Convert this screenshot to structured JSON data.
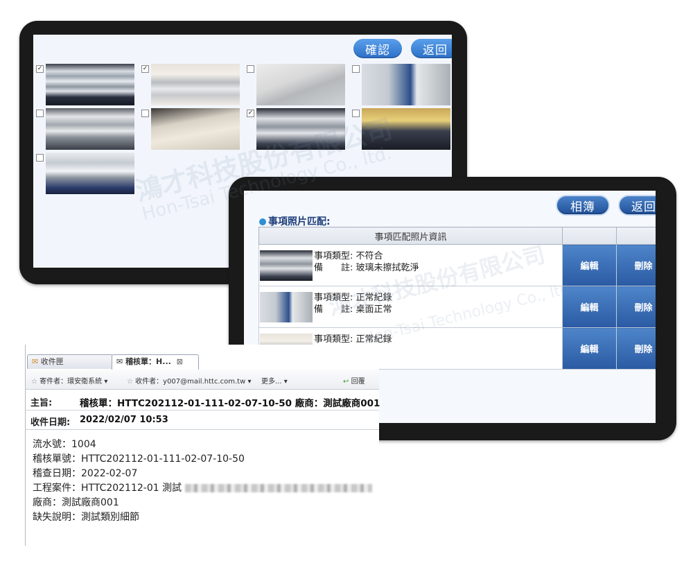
{
  "photo_picker": {
    "confirm_label": "確認",
    "back_label": "返回",
    "photos": [
      {
        "checked": true,
        "thumb": "t1"
      },
      {
        "checked": true,
        "thumb": "t2"
      },
      {
        "checked": false,
        "thumb": "t3"
      },
      {
        "checked": false,
        "thumb": "t4"
      },
      {
        "checked": false,
        "thumb": "t5"
      },
      {
        "checked": false,
        "thumb": "t6"
      },
      {
        "checked": true,
        "thumb": "t7"
      },
      {
        "checked": false,
        "thumb": "t8"
      },
      {
        "checked": false,
        "thumb": "t9"
      }
    ]
  },
  "matching": {
    "album_label": "相簿",
    "back_label": "返回",
    "section_title": "事項照片匹配:",
    "table_header": "事項匹配照片資訊",
    "type_label": "事項類型:",
    "note_label": "備　　註:",
    "edit_label": "編輯",
    "delete_label": "刪除",
    "rows": [
      {
        "type": "不符合",
        "note": "玻璃未擦拭乾淨"
      },
      {
        "type": "正常紀錄",
        "note": "桌面正常"
      },
      {
        "type": "正常紀錄",
        "note": ""
      }
    ]
  },
  "email": {
    "tab_inbox": "收件匣",
    "tab_current": "稽核單：H...",
    "sender": "寄件者：環安衛系統",
    "recipient": "收件者：y007@mail.httc.com.tw",
    "more": "更多...",
    "reply": "回覆",
    "subject_label": "主旨:",
    "subject_value": "稽核單：HTTC202112-01-111-02-07-10-50 廠商：測試廠商001",
    "date_label": "收件日期:",
    "date_value": "2022/02/07 10:53",
    "body": {
      "serial": "流水號：1004",
      "audit_no": "稽核單號：HTTC202112-01-111-02-07-10-50",
      "audit_date": "稽查日期：2022-02-07",
      "project": "工程案件：HTTC202112-01 測試",
      "vendor": "廠商：測試廠商001",
      "defect": "缺失說明：測試類別細節"
    }
  },
  "watermark": {
    "cn": "鴻才科技股份有限公司",
    "en": "Hon-Tsai Technology Co., ltd."
  },
  "colors": {
    "accent": "#2c6fc7",
    "frame": "#1a1a1a"
  }
}
